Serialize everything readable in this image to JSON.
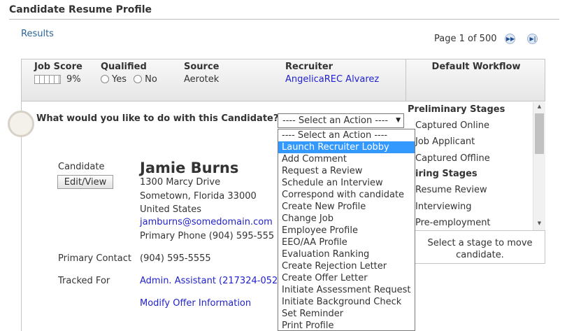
{
  "page": {
    "title": "Candidate Resume Profile"
  },
  "results_link": "Results",
  "pager": {
    "label": "Page 1 of 500",
    "next_icon": "next-page-icon",
    "last_icon": "last-page-icon"
  },
  "summary": {
    "job_score": {
      "label": "Job Score",
      "value": "9%"
    },
    "qualified": {
      "label": "Qualified",
      "yes": "Yes",
      "no": "No"
    },
    "source": {
      "label": "Source",
      "value": "Aerotek"
    },
    "recruiter": {
      "label": "Recruiter",
      "value": "AngelicaREC Alvarez"
    },
    "workflow_title": "Default Workflow"
  },
  "action": {
    "question": "What would you like to do with this Candidate?",
    "selected": "---- Select an Action ----",
    "options": [
      "---- Select an Action ----",
      "Launch Recruiter Lobby",
      "Add Comment",
      "Request a Review",
      "Schedule an Interview",
      "Correspond with candidate",
      "Create New Profile",
      "Change Job",
      "Employee Profile",
      "EEO/AA Profile",
      "Evaluation Ranking",
      "Create Rejection Letter",
      "Create Offer Letter",
      "Initiate Assessment Request",
      "Initiate Background Check",
      "Set Reminder",
      "Print Profile"
    ],
    "highlighted_index": 1
  },
  "candidate": {
    "label": "Candidate",
    "edit_button": "Edit/View",
    "name": "Jamie Burns",
    "address1": "1300 Marcy Drive",
    "address2": "Sometown, Florida  33000",
    "country": "United States",
    "email": "jamburns@somedomain.com",
    "phone": "Primary Phone (904) 595-555",
    "primary_contact_label": "Primary Contact",
    "primary_contact_value": "(904) 595-5555",
    "tracked_for_label": "Tracked For",
    "tracked_for_value": "Admin. Assistant (217324-052",
    "modify_offer": "Modify Offer Information"
  },
  "workflow": {
    "preliminary_head": "Preliminary Stages",
    "preliminary_items": [
      "Captured Online",
      "Job Applicant",
      "Captured Offline"
    ],
    "hiring_head": "iring Stages",
    "hiring_items": [
      "Resume Review",
      "Interviewing",
      "Pre-employment"
    ],
    "hint": "Select a stage to move candidate."
  }
}
